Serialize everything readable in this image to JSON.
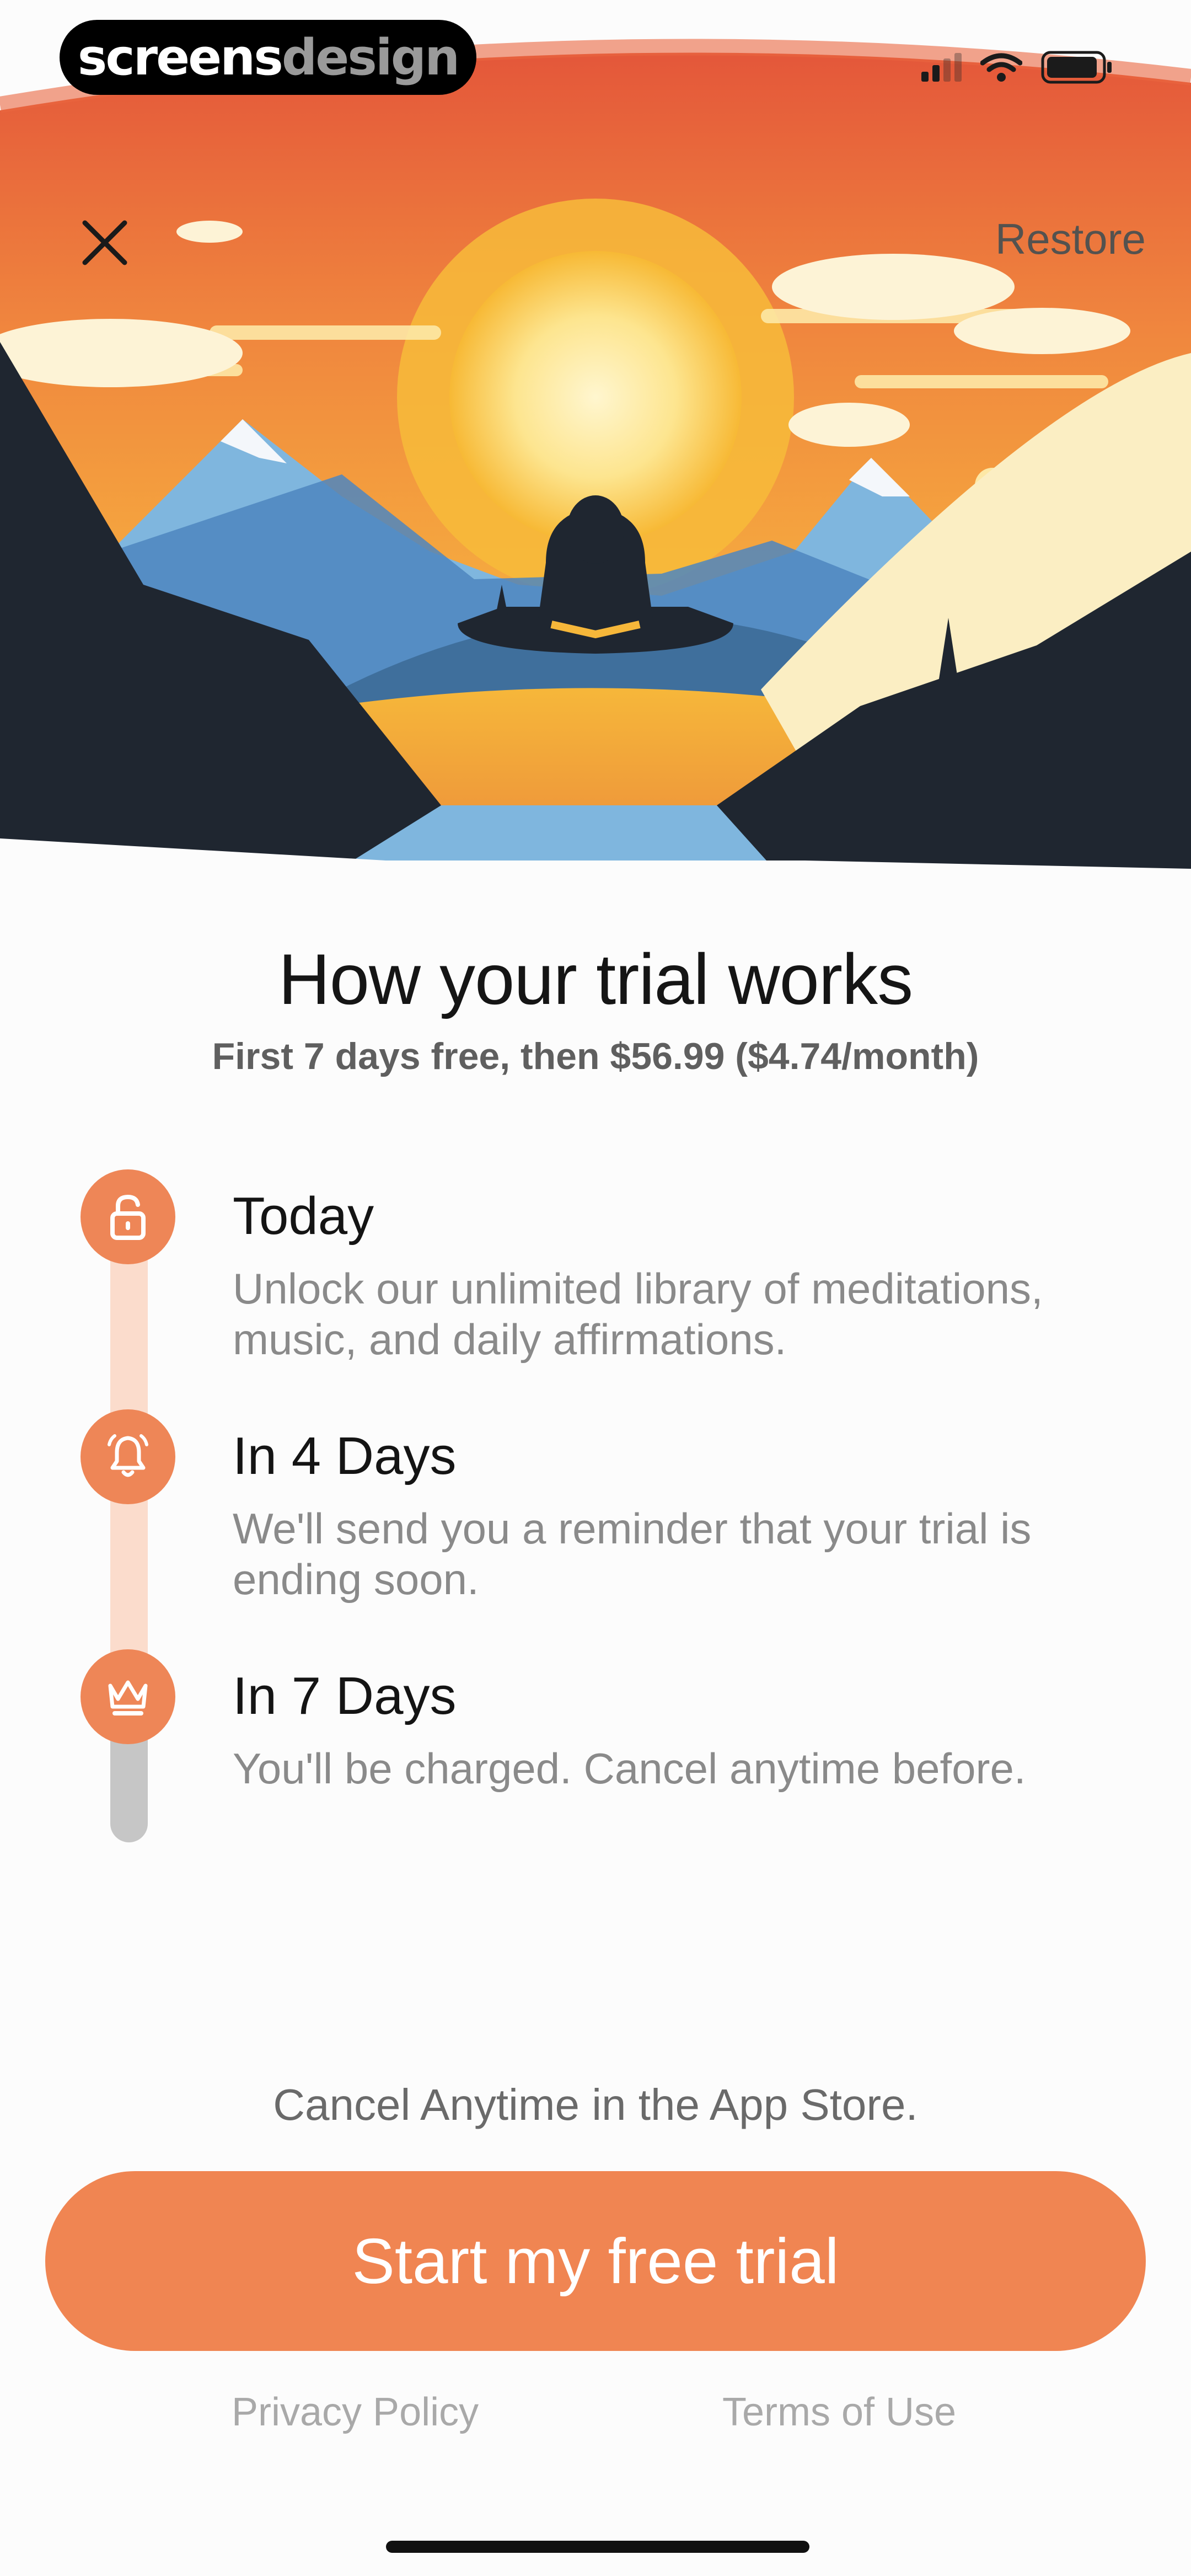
{
  "brand": {
    "part1": "screens",
    "part2": "design"
  },
  "status_bar": {
    "signal_bars_active": 2,
    "signal_bars_total": 4,
    "icons": [
      "cellular-signal-icon",
      "wifi-icon",
      "battery-icon"
    ]
  },
  "header": {
    "close_icon": "close-icon",
    "restore_label": "Restore"
  },
  "hero": {
    "illustration": "meditation-mountain-sunset"
  },
  "main": {
    "title": "How your trial works",
    "subtitle": "First 7 days free, then $56.99 ($4.74/month)"
  },
  "timeline": [
    {
      "icon": "unlock-icon",
      "title": "Today",
      "description": "Unlock our unlimited library of meditations, music, and daily affirmations."
    },
    {
      "icon": "bell-icon",
      "title": "In 4 Days",
      "description": "We'll send you a reminder that your trial is ending soon."
    },
    {
      "icon": "crown-icon",
      "title": "In 7 Days",
      "description": "You'll be charged. Cancel anytime before."
    }
  ],
  "footer": {
    "cancel_note": "Cancel Anytime in the App Store.",
    "cta_label": "Start my free trial",
    "privacy_label": "Privacy Policy",
    "terms_label": "Terms of Use"
  },
  "colors": {
    "accent": "#f08552",
    "timeline_track": "#fbdccc",
    "timeline_track_end": "#c6c6c6",
    "background": "#fcfcfc"
  }
}
